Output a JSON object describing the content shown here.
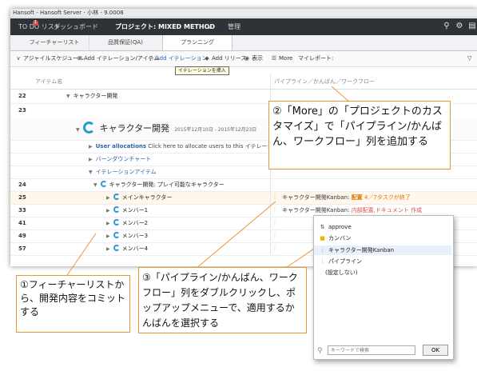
{
  "window": {
    "title": "Hansoft - Hansoft Server - 小林 - 9.0008"
  },
  "topbar": {
    "todo": "TO DO リスト",
    "todo_badge": "1",
    "dashboard": "ダッシュボード",
    "project": "プロジェクト: MIXED METHOD",
    "project_caret": "∨",
    "manage": "管理"
  },
  "tabs": [
    "フィーチャーリスト",
    "品質保証(QA)",
    "プランニング"
  ],
  "toolbar": {
    "agile": "アジャイルスケジュール",
    "add_iteration_item": "Add イテレーション/アイテム",
    "add_iteration": "Add イテレーション",
    "add_release": "Add リリース",
    "view": "表示",
    "more": "More",
    "myreport": "マイレポート:"
  },
  "tooltip": "イテレーションを挿入",
  "columns": {
    "item_name": "アイテム名",
    "pipeline": "パイプライン／かんばん／ワークフロー"
  },
  "rows": {
    "r22": {
      "num": "22",
      "label": "キャラクター開発"
    },
    "r23": {
      "num": "23"
    },
    "sprint": {
      "label": "キャラクター開発",
      "dates": "2015年12月10日 - 2015年12月23日"
    },
    "alloc": {
      "label": "User allocations",
      "desc": "Click here to allocate users to this イテレーション"
    },
    "burndown": {
      "label": "バーンダウンチャート"
    },
    "iteration_items": {
      "label": "イテレーションアイテム"
    },
    "r24": {
      "num": "24",
      "label": "キャラクター開発: プレイ可能なキャラクター"
    },
    "r25": {
      "num": "25",
      "label": "メインキャラクター",
      "board": "キャラクター開発Kanban:",
      "status": "配置",
      "extra": "4／7タスクが終了"
    },
    "r33": {
      "num": "33",
      "label": "メンバー1",
      "board": "キャラクター開発Kanban:",
      "status": "内部配置,ドキュメント 作成"
    },
    "r41": {
      "num": "41",
      "label": "メンバー2"
    },
    "r49": {
      "num": "49",
      "label": "メンバー3"
    },
    "r57": {
      "num": "57",
      "label": "メンバー4"
    }
  },
  "popup": {
    "items": [
      "approve",
      "カンバン",
      "キャラクター開発Kanban",
      "パイプライン",
      "(設定しない)"
    ],
    "search_placeholder": "キーワードで検索",
    "ok": "OK"
  },
  "callouts": {
    "c1": "①フィーチャーリストから、開発内容をコミットする",
    "c2": "②「More」の「プロジェクトのカスタマイズ」で「パイプライン/かんばん、ワークフロー」列を追加する",
    "c3": "③「パイプライン/かんばん、ワークフロー」列をダブルクリックし、ポップアップメニューで、適用するかんばんを選択する"
  },
  "colors": {
    "accent": "#e8973a",
    "link": "#2a62b0",
    "status_orange": "#e07800",
    "status_red": "#d9534f",
    "topbar": "#2d3338"
  }
}
